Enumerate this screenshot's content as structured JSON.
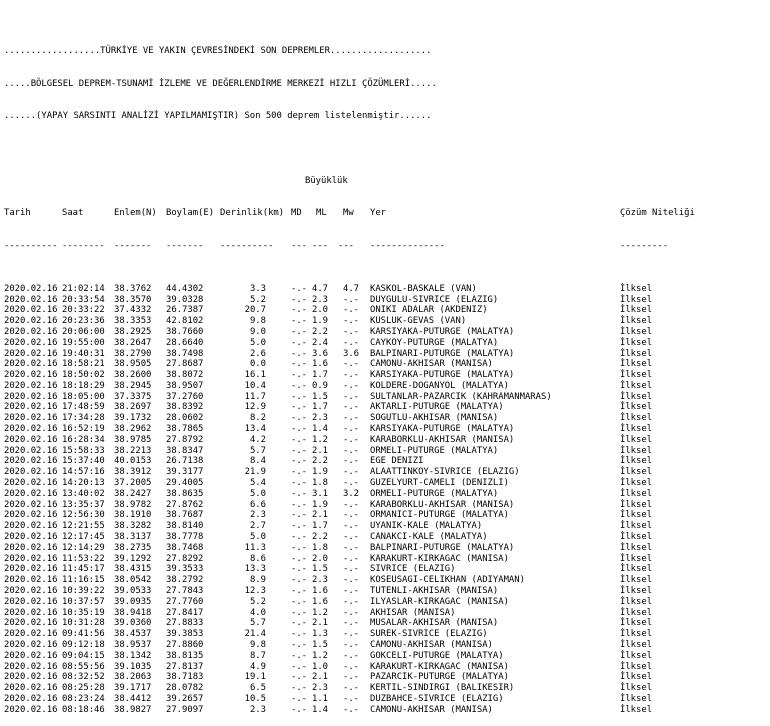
{
  "header": {
    "line1": "..................TÜRKİYE VE YAKIN ÇEVRESİNDEKİ SON DEPREMLER...................",
    "line2": ".....BÖLGESEL DEPREM-TSUNAMİ İZLEME VE DEĞERLENDİRME MERKEZİ HIZLI ÇÖZÜMLERİ.....",
    "line3": "......(YAPAY SARSINTI ANALİZİ YAPILMAMIŞTIR) Son 500 deprem listelenmiştir......"
  },
  "columns": {
    "buyukluk": "Büyüklük",
    "tarih": "Tarih",
    "saat": "Saat",
    "enlem": "Enlem(N)",
    "boylam": "Boylam(E)",
    "derinlik": "Derinlik(km)",
    "md": "MD",
    "ml": "ML",
    "mw": "Mw",
    "yer": "Yer",
    "cozum": "Çözüm Niteliği"
  },
  "underline": {
    "tarih": "----------",
    "saat": "--------",
    "enlem": "-------",
    "boylam": "-------",
    "derinlik": "----------",
    "md": "---",
    "ml": "---",
    "mw": "---",
    "yer": "--------------",
    "cozum": "---------"
  },
  "rows": [
    [
      "2020.02.16",
      "21:02:14",
      "38.3762",
      "44.4302",
      "3.3",
      "-.-",
      "4.7",
      "4.7",
      "KASKOL-BASKALE (VAN)",
      "İlksel"
    ],
    [
      "2020.02.16",
      "20:33:54",
      "38.3570",
      "39.0328",
      "5.2",
      "-.-",
      "2.3",
      "-.-",
      "DUYGULU-SIVRICE (ELAZIG)",
      "İlksel"
    ],
    [
      "2020.02.16",
      "20:33:22",
      "37.4332",
      "26.7387",
      "20.7",
      "-.-",
      "2.0",
      "-.-",
      "ONIKI ADALAR (AKDENIZ)",
      "İlksel"
    ],
    [
      "2020.02.16",
      "20:23:36",
      "38.3353",
      "42.8102",
      "9.8",
      "-.-",
      "1.9",
      "-.-",
      "KUSLUK-GEVAS (VAN)",
      "İlksel"
    ],
    [
      "2020.02.16",
      "20:06:00",
      "38.2925",
      "38.7660",
      "9.0",
      "-.-",
      "2.2",
      "-.-",
      "KARSIYAKA-PUTURGE (MALATYA)",
      "İlksel"
    ],
    [
      "2020.02.16",
      "19:55:00",
      "38.2647",
      "28.6640",
      "5.0",
      "-.-",
      "2.4",
      "-.-",
      "CAYKOY-PUTURGE (MALATYA)",
      "İlksel"
    ],
    [
      "2020.02.16",
      "19:40:31",
      "38.2790",
      "38.7498",
      "2.6",
      "-.-",
      "3.6",
      "3.6",
      "BALPINARI-PUTURGE (MALATYA)",
      "İlksel"
    ],
    [
      "2020.02.16",
      "18:58:21",
      "38.9505",
      "27.8687",
      "0.0",
      "-.-",
      "1.6",
      "-.-",
      "CAMONU-AKHISAR (MANISA)",
      "İlksel"
    ],
    [
      "2020.02.16",
      "18:50:02",
      "38.2600",
      "38.8072",
      "16.1",
      "-.-",
      "1.7",
      "-.-",
      "KARSIYAKA-PUTURGE (MALATYA)",
      "İlksel"
    ],
    [
      "2020.02.16",
      "18:18:29",
      "38.2945",
      "38.9507",
      "10.4",
      "-.-",
      "0.9",
      "-.-",
      "KOLDERE-DOGANYOL (MALATYA)",
      "İlksel"
    ],
    [
      "2020.02.16",
      "18:05:00",
      "37.3375",
      "37.2760",
      "11.7",
      "-.-",
      "1.5",
      "-.-",
      "SULTANLAR-PAZARCIK (KAHRAMANMARAS)",
      "İlksel"
    ],
    [
      "2020.02.16",
      "17:48:59",
      "38.2697",
      "38.8392",
      "12.9",
      "-.-",
      "1.7",
      "-.-",
      "AKTARLI-PUTURGE (MALATYA)",
      "İlksel"
    ],
    [
      "2020.02.16",
      "17:34:28",
      "39.1732",
      "28.0602",
      "8.2",
      "-.-",
      "2.3",
      "-.-",
      "SOGUTLU-AKHISAR (MANISA)",
      "İlksel"
    ],
    [
      "2020.02.16",
      "16:52:19",
      "38.2962",
      "38.7865",
      "13.4",
      "-.-",
      "1.4",
      "-.-",
      "KARSIYAKA-PUTURGE (MALATYA)",
      "İlksel"
    ],
    [
      "2020.02.16",
      "16:28:34",
      "38.9785",
      "27.8792",
      "4.2",
      "-.-",
      "1.2",
      "-.-",
      "KARABORKLU-AKHISAR (MANISA)",
      "İlksel"
    ],
    [
      "2020.02.16",
      "15:58:33",
      "38.2213",
      "38.8347",
      "5.7",
      "-.-",
      "2.1",
      "-.-",
      "ORMELI-PUTURGE (MALATYA)",
      "İlksel"
    ],
    [
      "2020.02.16",
      "15:37:40",
      "40.0153",
      "26.7138",
      "8.4",
      "-.-",
      "2.2",
      "-.-",
      "EGE DENIZI",
      "İlksel"
    ],
    [
      "2020.02.16",
      "14:57:16",
      "38.3912",
      "39.3177",
      "21.9",
      "-.-",
      "1.9",
      "-.-",
      "ALAATTINKOY-SIVRICE (ELAZIG)",
      "İlksel"
    ],
    [
      "2020.02.16",
      "14:20:13",
      "37.2005",
      "29.4005",
      "5.4",
      "-.-",
      "1.8",
      "-.-",
      "GUZELYURT-CAMELI (DENIZLI)",
      "İlksel"
    ],
    [
      "2020.02.16",
      "13:40:02",
      "38.2427",
      "38.8635",
      "5.0",
      "-.-",
      "3.1",
      "3.2",
      "ORMELI-PUTURGE (MALATYA)",
      "İlksel"
    ],
    [
      "2020.02.16",
      "13:35:37",
      "38.9782",
      "27.8762",
      "6.6",
      "-.-",
      "1.9",
      "-.-",
      "KARABORKLU-AKHISAR (MANISA)",
      "İlksel"
    ],
    [
      "2020.02.16",
      "12:56:30",
      "38.1910",
      "38.7687",
      "2.3",
      "-.-",
      "2.1",
      "-.-",
      "ORMANICI-PUTURGE (MALATYA)",
      "İlksel"
    ],
    [
      "2020.02.16",
      "12:21:55",
      "38.3282",
      "38.8140",
      "2.7",
      "-.-",
      "1.7",
      "-.-",
      "UYANIK-KALE (MALATYA)",
      "İlksel"
    ],
    [
      "2020.02.16",
      "12:17:45",
      "38.3137",
      "38.7778",
      "5.0",
      "-.-",
      "2.2",
      "-.-",
      "CANAKCI-KALE (MALATYA)",
      "İlksel"
    ],
    [
      "2020.02.16",
      "12:14:29",
      "38.2735",
      "38.7468",
      "11.3",
      "-.-",
      "1.8",
      "-.-",
      "BALPINARI-PUTURGE (MALATYA)",
      "İlksel"
    ],
    [
      "2020.02.16",
      "11:53:22",
      "39.1292",
      "27.8292",
      "8.6",
      "-.-",
      "2.0",
      "-.-",
      "KARAKURT-KIRKAGAC (MANISA)",
      "İlksel"
    ],
    [
      "2020.02.16",
      "11:45:17",
      "38.4315",
      "39.3533",
      "13.3",
      "-.-",
      "1.5",
      "-.-",
      "SIVRICE (ELAZIG)",
      "İlksel"
    ],
    [
      "2020.02.16",
      "11:16:15",
      "38.0542",
      "38.2792",
      "8.9",
      "-.-",
      "2.3",
      "-.-",
      "KOSEUSAGI-CELIKHAN (ADIYAMAN)",
      "İlksel"
    ],
    [
      "2020.02.16",
      "10:39:22",
      "39.0533",
      "27.7843",
      "12.3",
      "-.-",
      "1.6",
      "-.-",
      "TUTENLI-AKHISAR (MANISA)",
      "İlksel"
    ],
    [
      "2020.02.16",
      "10:37:57",
      "39.0935",
      "27.7760",
      "5.2",
      "-.-",
      "1.6",
      "-.-",
      "ILYASLAR-KIRKAGAC (MANISA)",
      "İlksel"
    ],
    [
      "2020.02.16",
      "10:35:19",
      "38.9418",
      "27.8417",
      "4.0",
      "-.-",
      "1.2",
      "-.-",
      "AKHISAR (MANISA)",
      "İlksel"
    ],
    [
      "2020.02.16",
      "10:31:28",
      "39.0360",
      "27.8833",
      "5.7",
      "-.-",
      "2.1",
      "-.-",
      "MUSALAR-AKHISAR (MANISA)",
      "İlksel"
    ],
    [
      "2020.02.16",
      "09:41:56",
      "38.4537",
      "39.3853",
      "21.4",
      "-.-",
      "1.3",
      "-.-",
      "SUREK-SIVRICE (ELAZIG)",
      "İlksel"
    ],
    [
      "2020.02.16",
      "09:12:18",
      "38.9537",
      "27.8860",
      "9.8",
      "-.-",
      "1.5",
      "-.-",
      "CAMONU-AKHISAR (MANISA)",
      "İlksel"
    ],
    [
      "2020.02.16",
      "09:04:15",
      "38.1342",
      "38.8135",
      "8.7",
      "-.-",
      "1.2",
      "-.-",
      "GOKCELI-PUTURGE (MALATYA)",
      "İlksel"
    ],
    [
      "2020.02.16",
      "08:55:56",
      "39.1035",
      "27.8137",
      "4.9",
      "-.-",
      "1.0",
      "-.-",
      "KARAKURT-KIRKAGAC (MANISA)",
      "İlksel"
    ],
    [
      "2020.02.16",
      "08:32:52",
      "38.2063",
      "38.7183",
      "19.1",
      "-.-",
      "2.1",
      "-.-",
      "PAZARCIK-PUTURGE (MALATYA)",
      "İlksel"
    ],
    [
      "2020.02.16",
      "08:25:28",
      "39.1717",
      "28.0782",
      "6.5",
      "-.-",
      "2.3",
      "-.-",
      "KERTIL-SINDIRGI (BALIKESIR)",
      "İlksel"
    ],
    [
      "2020.02.16",
      "08:23:24",
      "38.4412",
      "39.2657",
      "10.5",
      "-.-",
      "1.1",
      "-.-",
      "DUZBAHCE-SIVRICE (ELAZIG)",
      "İlksel"
    ],
    [
      "2020.02.16",
      "08:18:46",
      "38.9827",
      "27.9097",
      "2.3",
      "-.-",
      "1.4",
      "-.-",
      "CAMONU-AKHISAR (MANISA)",
      "İlksel"
    ]
  ]
}
